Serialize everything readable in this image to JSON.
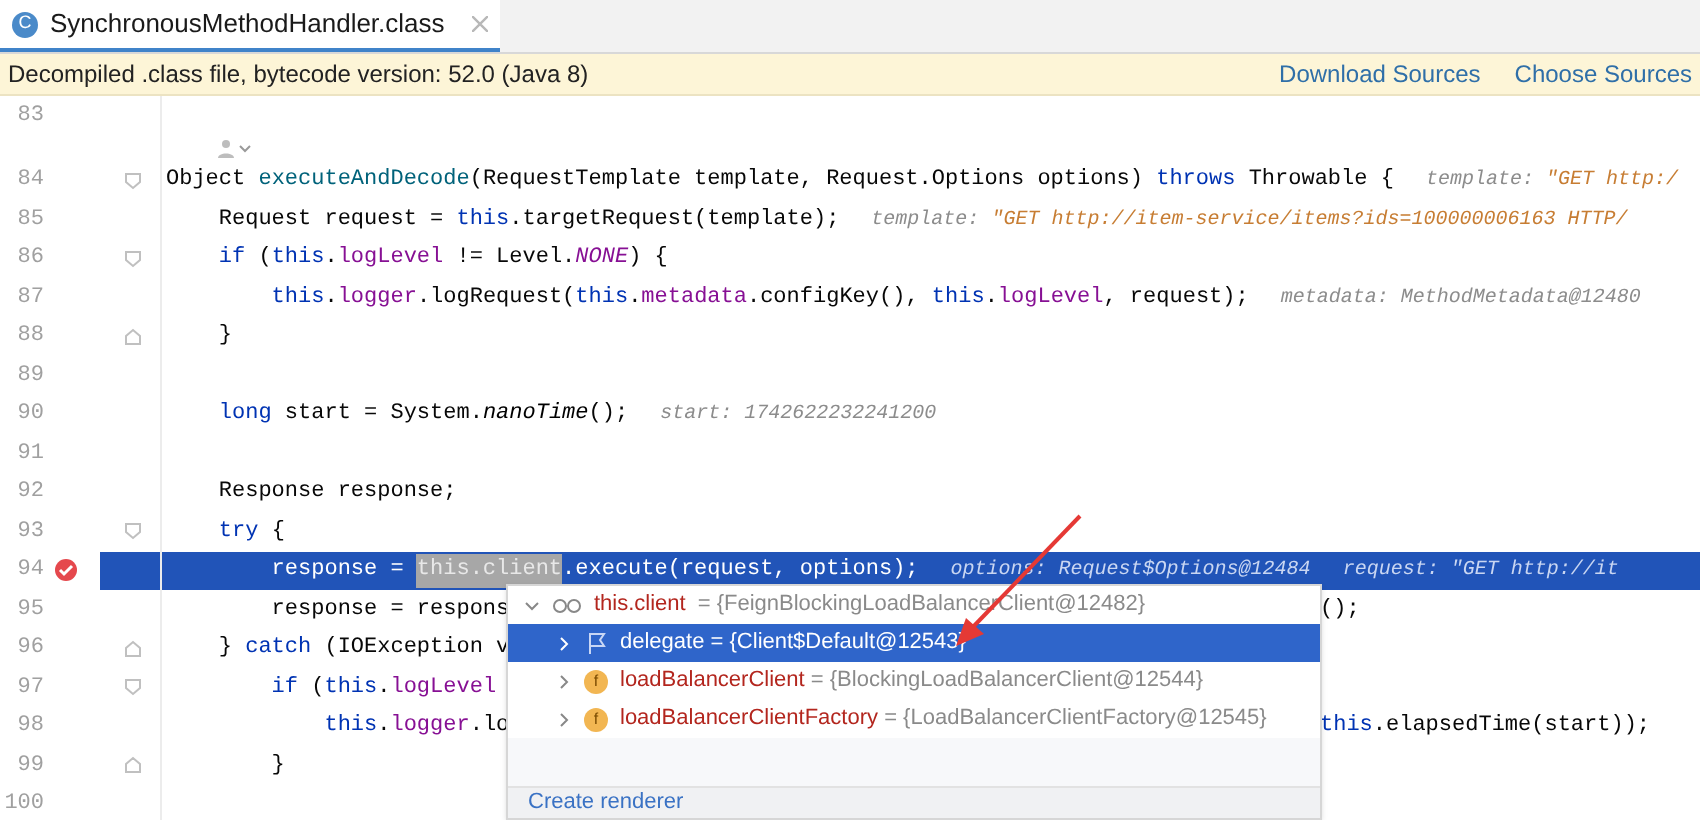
{
  "tab": {
    "label": "SynchronousMethodHandler.class",
    "icon_letter": "C",
    "selected": true
  },
  "banner": {
    "message": "Decompiled .class file, bytecode version: 52.0 (Java 8)",
    "links": [
      "Download Sources",
      "Choose Sources"
    ]
  },
  "editor": {
    "lines": [
      {
        "kind": "code",
        "number": "83",
        "selected": false,
        "breakpoint": false
      },
      {
        "kind": "author_inlay"
      },
      {
        "kind": "fold_start",
        "number": "84",
        "selected": false,
        "breakpoint": false,
        "segments": [
          {
            "kind": "plain",
            "text": "Object "
          },
          {
            "kind": "method_decl",
            "text": "executeAndDecode"
          },
          {
            "kind": "plain",
            "text": "(RequestTemplate template, Request.Options options) "
          },
          {
            "kind": "keyword",
            "text": "throws"
          },
          {
            "kind": "plain",
            "text": " Throwable {"
          },
          {
            "kind": "hint",
            "text": "template: "
          },
          {
            "kind": "hint_value",
            "text": "\"GET http:/"
          }
        ]
      },
      {
        "kind": "code",
        "number": "85",
        "selected": false,
        "breakpoint": false,
        "segments": [
          {
            "kind": "plain",
            "text": "    Request request = "
          },
          {
            "kind": "keyword",
            "text": "this"
          },
          {
            "kind": "plain",
            "text": ".targetRequest(template);"
          },
          {
            "kind": "hint",
            "text": "template: "
          },
          {
            "kind": "hint_value",
            "text": "\"GET http://item-service/items?ids=100000006163 HTTP/"
          }
        ]
      },
      {
        "kind": "fold_start",
        "number": "86",
        "selected": false,
        "breakpoint": false,
        "segments": [
          {
            "kind": "keyword",
            "text": "    if"
          },
          {
            "kind": "plain",
            "text": " ("
          },
          {
            "kind": "keyword",
            "text": "this"
          },
          {
            "kind": "plain",
            "text": "."
          },
          {
            "kind": "field",
            "text": "logLevel"
          },
          {
            "kind": "plain",
            "text": " != Level."
          },
          {
            "kind": "static_field",
            "text": "NONE"
          },
          {
            "kind": "plain",
            "text": ") {"
          }
        ]
      },
      {
        "kind": "code",
        "number": "87",
        "selected": false,
        "breakpoint": false,
        "segments": [
          {
            "kind": "keyword",
            "text": "        this"
          },
          {
            "kind": "plain",
            "text": "."
          },
          {
            "kind": "field",
            "text": "logger"
          },
          {
            "kind": "plain",
            "text": ".logRequest("
          },
          {
            "kind": "keyword",
            "text": "this"
          },
          {
            "kind": "plain",
            "text": "."
          },
          {
            "kind": "field",
            "text": "metadata"
          },
          {
            "kind": "plain",
            "text": ".configKey(), "
          },
          {
            "kind": "keyword",
            "text": "this"
          },
          {
            "kind": "plain",
            "text": "."
          },
          {
            "kind": "field",
            "text": "logLevel"
          },
          {
            "kind": "plain",
            "text": ", request);"
          },
          {
            "kind": "hint",
            "text": "metadata: MethodMetadata@12480"
          }
        ]
      },
      {
        "kind": "fold_end",
        "number": "88",
        "selected": false,
        "breakpoint": false,
        "segments": [
          {
            "kind": "plain",
            "text": "    }"
          }
        ]
      },
      {
        "kind": "code",
        "number": "89",
        "selected": false,
        "breakpoint": false
      },
      {
        "kind": "code",
        "number": "90",
        "selected": false,
        "breakpoint": false,
        "segments": [
          {
            "kind": "keyword",
            "text": "    long"
          },
          {
            "kind": "plain",
            "text": " start = System."
          },
          {
            "kind": "static",
            "text": "nanoTime"
          },
          {
            "kind": "plain",
            "text": "();"
          },
          {
            "kind": "hint",
            "text": "start: 1742622232241200"
          }
        ]
      },
      {
        "kind": "code",
        "number": "91",
        "selected": false,
        "breakpoint": false
      },
      {
        "kind": "code",
        "number": "92",
        "selected": false,
        "breakpoint": false,
        "segments": [
          {
            "kind": "plain",
            "text": "    Response response;"
          }
        ]
      },
      {
        "kind": "fold_start",
        "number": "93",
        "selected": false,
        "breakpoint": false,
        "segments": [
          {
            "kind": "keyword",
            "text": "    try"
          },
          {
            "kind": "plain",
            "text": " {"
          }
        ]
      },
      {
        "kind": "code",
        "number": "94",
        "selected": true,
        "breakpoint": true,
        "segments": [
          {
            "kind": "plain",
            "text": "        response = "
          },
          {
            "kind": "selection",
            "text": "this.client"
          },
          {
            "kind": "plain",
            "text": ".execute(request, options);"
          },
          {
            "kind": "hint",
            "text": "options: Request$Options@12484"
          },
          {
            "kind": "hint",
            "text": "request: \"GET http://it"
          }
        ]
      },
      {
        "kind": "code",
        "number": "95",
        "selected": false,
        "breakpoint": false,
        "segments": [
          {
            "kind": "plain",
            "text": "        response = respons"
          }
        ],
        "tail": [
          {
            "kind": "plain",
            "text": "();"
          }
        ]
      },
      {
        "kind": "fold_end",
        "number": "96",
        "selected": false,
        "breakpoint": false,
        "segments": [
          {
            "kind": "plain",
            "text": "    } "
          },
          {
            "kind": "keyword",
            "text": "catch"
          },
          {
            "kind": "plain",
            "text": " (IOException v"
          }
        ]
      },
      {
        "kind": "fold_start",
        "number": "97",
        "selected": false,
        "breakpoint": false,
        "segments": [
          {
            "kind": "keyword",
            "text": "        if"
          },
          {
            "kind": "plain",
            "text": " ("
          },
          {
            "kind": "keyword",
            "text": "this"
          },
          {
            "kind": "plain",
            "text": "."
          },
          {
            "kind": "field",
            "text": "logLevel"
          }
        ]
      },
      {
        "kind": "code",
        "number": "98",
        "selected": false,
        "breakpoint": false,
        "segments": [
          {
            "kind": "keyword",
            "text": "            this"
          },
          {
            "kind": "plain",
            "text": "."
          },
          {
            "kind": "field",
            "text": "logger"
          },
          {
            "kind": "plain",
            "text": ".lo"
          }
        ],
        "tail": [
          {
            "kind": "keyword",
            "text": "this"
          },
          {
            "kind": "plain",
            "text": ".elapsedTime(start));"
          }
        ]
      },
      {
        "kind": "fold_end",
        "number": "99",
        "selected": false,
        "breakpoint": false,
        "segments": [
          {
            "kind": "plain",
            "text": "        }"
          }
        ]
      },
      {
        "kind": "code",
        "number": "100",
        "selected": false,
        "breakpoint": false
      }
    ]
  },
  "popup": {
    "header": {
      "name": "this.client",
      "value": "= {FeignBlockingLoadBalancerClient@12482}",
      "expanded": true
    },
    "items": [
      {
        "kind": "flag",
        "name": "delegate",
        "value": "= {Client$Default@12543}",
        "selected": true,
        "expanded": false
      },
      {
        "kind": "field",
        "badge": "f",
        "name": "loadBalancerClient",
        "value": "= {BlockingLoadBalancerClient@12544}",
        "selected": false,
        "expanded": false
      },
      {
        "kind": "field",
        "badge": "f",
        "name": "loadBalancerClientFactory",
        "value": "= {LoadBalancerClientFactory@12545}",
        "selected": false,
        "expanded": false
      }
    ],
    "footer_link": "Create renderer"
  }
}
